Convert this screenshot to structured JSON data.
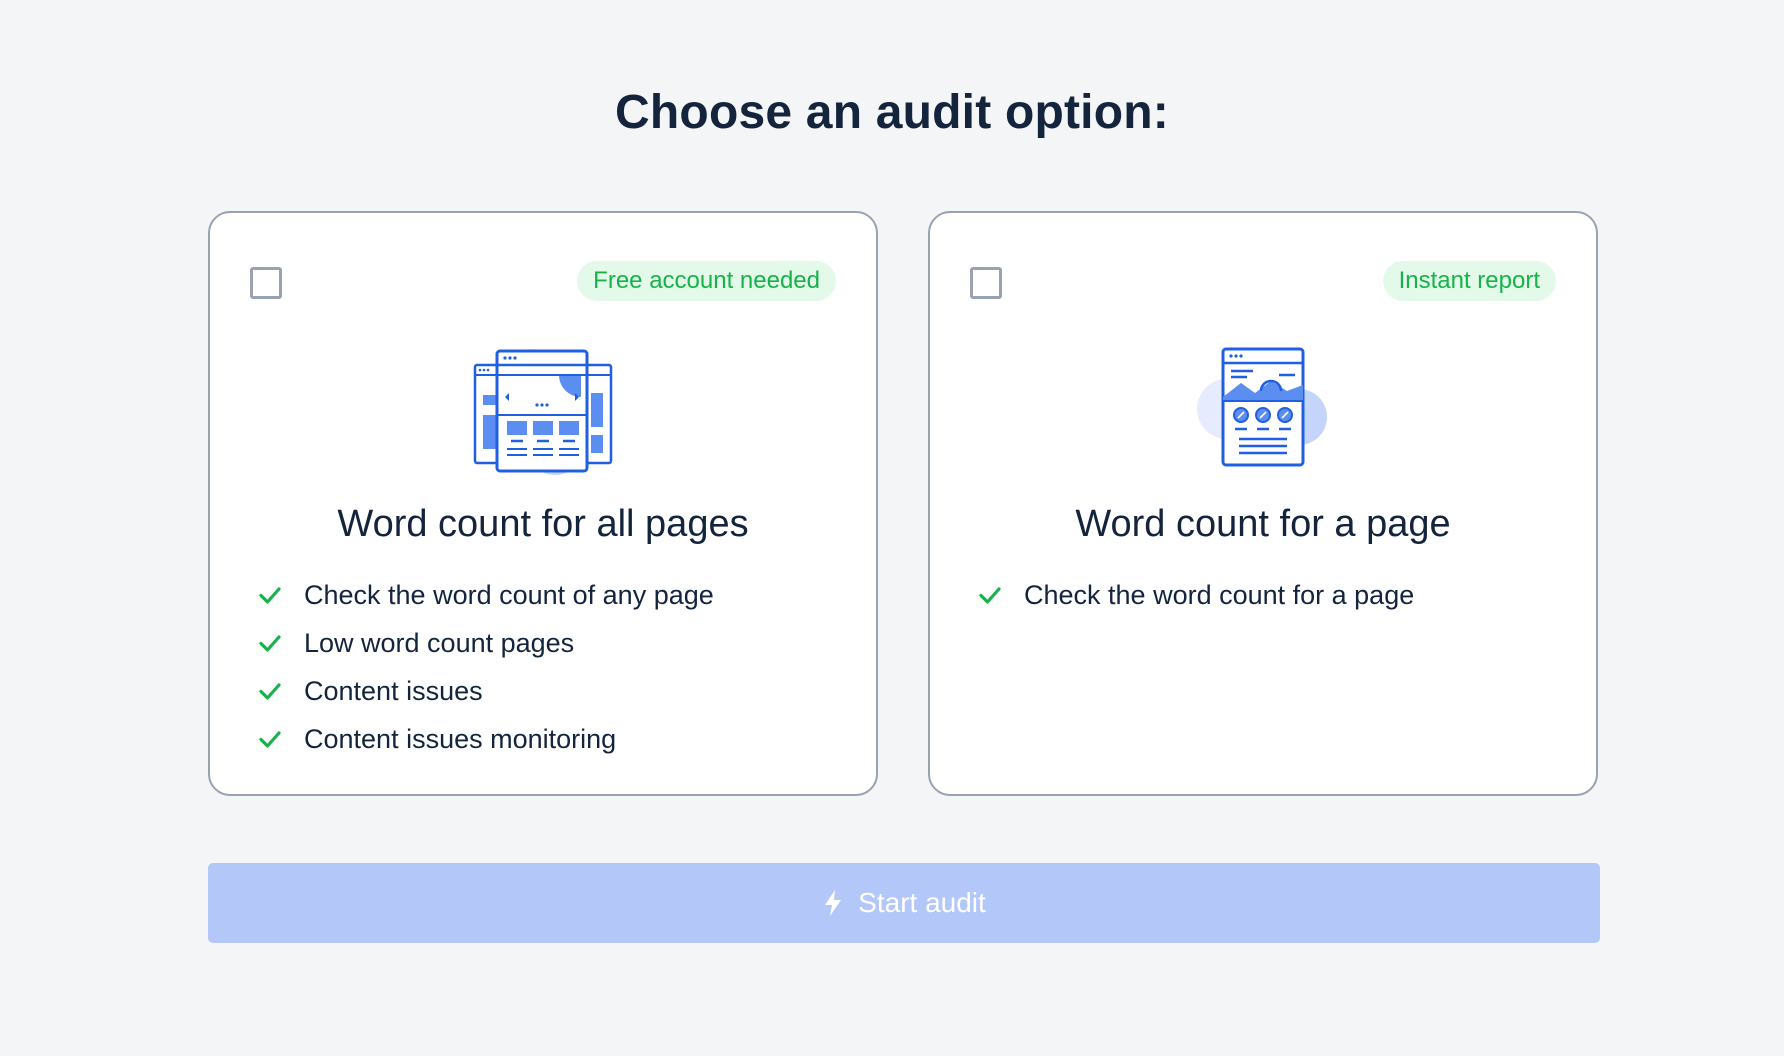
{
  "page_title": "Choose an audit option:",
  "options": [
    {
      "badge": "Free account needed",
      "title": "Word count for all pages",
      "features": [
        "Check the word count of any page",
        "Low word count pages",
        "Content issues",
        "Content issues monitoring"
      ],
      "icon": "multi-page-icon",
      "checked": false
    },
    {
      "badge": "Instant report",
      "title": "Word count for a page",
      "features": [
        "Check the word count for a page"
      ],
      "icon": "single-page-icon",
      "checked": false
    }
  ],
  "start_button": {
    "label": "Start audit",
    "icon": "lightning-icon",
    "state": "disabled"
  },
  "colors": {
    "background": "#f3f5f7",
    "badge_bg": "#e3f9e9",
    "badge_text": "#17b34a",
    "check": "#17b34a",
    "button_bg": "#b3c8f8",
    "accent_blue": "#1f5fe0",
    "text": "#14243d"
  }
}
